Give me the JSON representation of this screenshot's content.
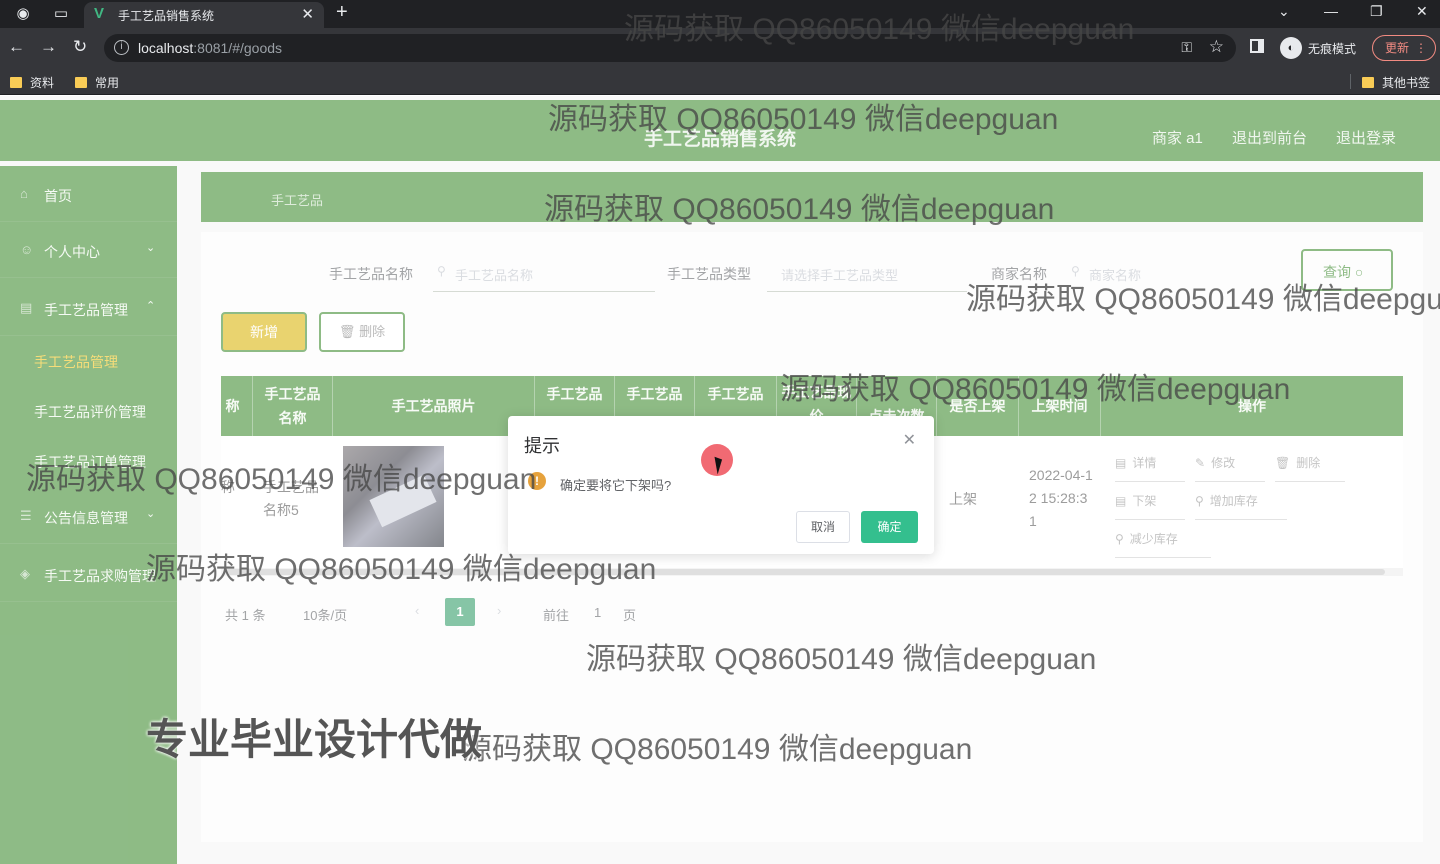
{
  "browser": {
    "tab_title": "手工艺品销售系统",
    "url_host": "localhost",
    "url_rest": ":8081/#/goods",
    "incognito_label": "无痕模式",
    "update_label": "更新",
    "bookmarks": [
      "资料",
      "常用"
    ],
    "other_bookmarks": "其他书签"
  },
  "header": {
    "title": "手工艺品销售系统",
    "user": "商家 a1",
    "back_front": "退出到前台",
    "logout": "退出登录"
  },
  "sidebar": {
    "items": [
      {
        "label": "首页"
      },
      {
        "label": "个人中心"
      },
      {
        "label": "手工艺品管理"
      },
      {
        "label": "手工艺品管理"
      },
      {
        "label": "手工艺品评价管理"
      },
      {
        "label": "手工艺品订单管理"
      },
      {
        "label": "公告信息管理"
      },
      {
        "label": "手工艺品求购管理"
      }
    ]
  },
  "breadcrumb": "手工艺品",
  "search": {
    "name_label": "手工艺品名称",
    "name_placeholder": "手工艺品名称",
    "type_label": "手工艺品类型",
    "type_placeholder": "请选择手工艺品类型",
    "shop_label": "商家名称",
    "shop_placeholder": "商家名称",
    "query_label": "查询"
  },
  "toolbar": {
    "add_label": "新增",
    "delete_label": "删除"
  },
  "table": {
    "headers": [
      "称",
      "手工艺品名称",
      "手工艺品照片",
      "手工艺品",
      "手工艺品",
      "手工艺品",
      "手工艺品现价",
      "点击次数",
      "是否上架",
      "上架时间",
      "操作"
    ],
    "row": {
      "col0": "称",
      "name": "手工艺品名称5",
      "on_shelf": "上架",
      "time": "2022-04-12 15:28:31",
      "ops": [
        "详情",
        "修改",
        "删除",
        "下架",
        "增加库存",
        "减少库存"
      ]
    }
  },
  "pager": {
    "total": "共 1 条",
    "page_size": "10条/页",
    "current": "1",
    "goto_label": "前往",
    "goto_value": "1",
    "page_unit": "页"
  },
  "dialog": {
    "title": "提示",
    "message": "确定要将它下架吗?",
    "cancel": "取消",
    "confirm": "确定"
  },
  "watermark": {
    "text": "源码获取 QQ86050149 微信deepguan",
    "promo": "专业毕业设计代做"
  }
}
